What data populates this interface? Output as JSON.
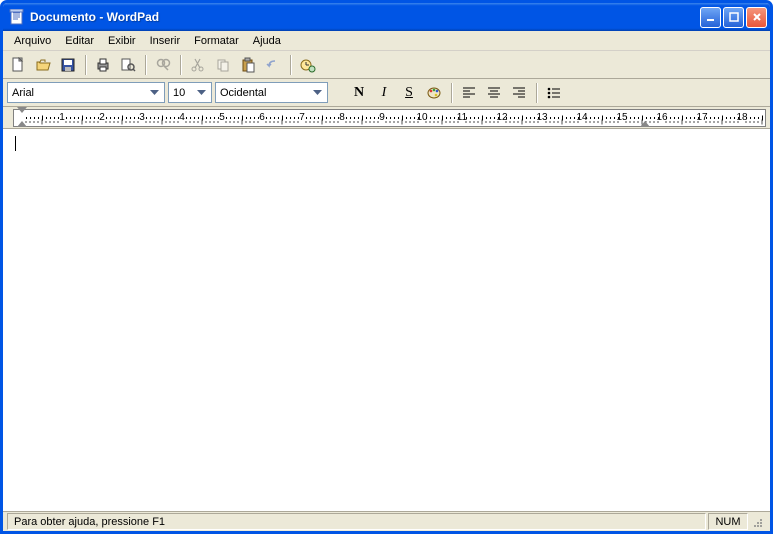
{
  "window": {
    "title": "Documento - WordPad"
  },
  "menu": {
    "items": [
      "Arquivo",
      "Editar",
      "Exibir",
      "Inserir",
      "Formatar",
      "Ajuda"
    ]
  },
  "format": {
    "font": "Arial",
    "size": "10",
    "encoding": "Ocidental",
    "bold_label": "N",
    "italic_label": "I",
    "underline_label": "S"
  },
  "ruler": {
    "numbers": [
      "1",
      "2",
      "3",
      "4",
      "5",
      "6",
      "7",
      "8",
      "9",
      "10",
      "11",
      "12",
      "13",
      "14",
      "15",
      "16",
      "17",
      "18"
    ]
  },
  "status": {
    "help": "Para obter ajuda, pressione F1",
    "num": "NUM"
  }
}
